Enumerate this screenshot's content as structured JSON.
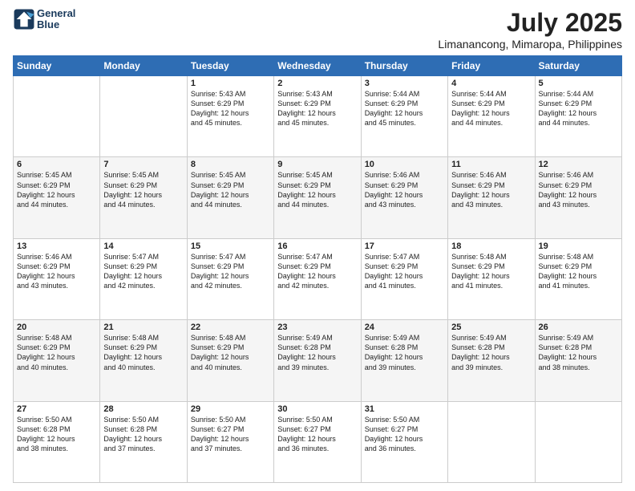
{
  "header": {
    "logo_line1": "General",
    "logo_line2": "Blue",
    "title": "July 2025",
    "subtitle": "Limanancong, Mimaropa, Philippines"
  },
  "weekdays": [
    "Sunday",
    "Monday",
    "Tuesday",
    "Wednesday",
    "Thursday",
    "Friday",
    "Saturday"
  ],
  "weeks": [
    [
      {
        "day": "",
        "info": ""
      },
      {
        "day": "",
        "info": ""
      },
      {
        "day": "1",
        "info": "Sunrise: 5:43 AM\nSunset: 6:29 PM\nDaylight: 12 hours\nand 45 minutes."
      },
      {
        "day": "2",
        "info": "Sunrise: 5:43 AM\nSunset: 6:29 PM\nDaylight: 12 hours\nand 45 minutes."
      },
      {
        "day": "3",
        "info": "Sunrise: 5:44 AM\nSunset: 6:29 PM\nDaylight: 12 hours\nand 45 minutes."
      },
      {
        "day": "4",
        "info": "Sunrise: 5:44 AM\nSunset: 6:29 PM\nDaylight: 12 hours\nand 44 minutes."
      },
      {
        "day": "5",
        "info": "Sunrise: 5:44 AM\nSunset: 6:29 PM\nDaylight: 12 hours\nand 44 minutes."
      }
    ],
    [
      {
        "day": "6",
        "info": "Sunrise: 5:45 AM\nSunset: 6:29 PM\nDaylight: 12 hours\nand 44 minutes."
      },
      {
        "day": "7",
        "info": "Sunrise: 5:45 AM\nSunset: 6:29 PM\nDaylight: 12 hours\nand 44 minutes."
      },
      {
        "day": "8",
        "info": "Sunrise: 5:45 AM\nSunset: 6:29 PM\nDaylight: 12 hours\nand 44 minutes."
      },
      {
        "day": "9",
        "info": "Sunrise: 5:45 AM\nSunset: 6:29 PM\nDaylight: 12 hours\nand 44 minutes."
      },
      {
        "day": "10",
        "info": "Sunrise: 5:46 AM\nSunset: 6:29 PM\nDaylight: 12 hours\nand 43 minutes."
      },
      {
        "day": "11",
        "info": "Sunrise: 5:46 AM\nSunset: 6:29 PM\nDaylight: 12 hours\nand 43 minutes."
      },
      {
        "day": "12",
        "info": "Sunrise: 5:46 AM\nSunset: 6:29 PM\nDaylight: 12 hours\nand 43 minutes."
      }
    ],
    [
      {
        "day": "13",
        "info": "Sunrise: 5:46 AM\nSunset: 6:29 PM\nDaylight: 12 hours\nand 43 minutes."
      },
      {
        "day": "14",
        "info": "Sunrise: 5:47 AM\nSunset: 6:29 PM\nDaylight: 12 hours\nand 42 minutes."
      },
      {
        "day": "15",
        "info": "Sunrise: 5:47 AM\nSunset: 6:29 PM\nDaylight: 12 hours\nand 42 minutes."
      },
      {
        "day": "16",
        "info": "Sunrise: 5:47 AM\nSunset: 6:29 PM\nDaylight: 12 hours\nand 42 minutes."
      },
      {
        "day": "17",
        "info": "Sunrise: 5:47 AM\nSunset: 6:29 PM\nDaylight: 12 hours\nand 41 minutes."
      },
      {
        "day": "18",
        "info": "Sunrise: 5:48 AM\nSunset: 6:29 PM\nDaylight: 12 hours\nand 41 minutes."
      },
      {
        "day": "19",
        "info": "Sunrise: 5:48 AM\nSunset: 6:29 PM\nDaylight: 12 hours\nand 41 minutes."
      }
    ],
    [
      {
        "day": "20",
        "info": "Sunrise: 5:48 AM\nSunset: 6:29 PM\nDaylight: 12 hours\nand 40 minutes."
      },
      {
        "day": "21",
        "info": "Sunrise: 5:48 AM\nSunset: 6:29 PM\nDaylight: 12 hours\nand 40 minutes."
      },
      {
        "day": "22",
        "info": "Sunrise: 5:48 AM\nSunset: 6:29 PM\nDaylight: 12 hours\nand 40 minutes."
      },
      {
        "day": "23",
        "info": "Sunrise: 5:49 AM\nSunset: 6:28 PM\nDaylight: 12 hours\nand 39 minutes."
      },
      {
        "day": "24",
        "info": "Sunrise: 5:49 AM\nSunset: 6:28 PM\nDaylight: 12 hours\nand 39 minutes."
      },
      {
        "day": "25",
        "info": "Sunrise: 5:49 AM\nSunset: 6:28 PM\nDaylight: 12 hours\nand 39 minutes."
      },
      {
        "day": "26",
        "info": "Sunrise: 5:49 AM\nSunset: 6:28 PM\nDaylight: 12 hours\nand 38 minutes."
      }
    ],
    [
      {
        "day": "27",
        "info": "Sunrise: 5:50 AM\nSunset: 6:28 PM\nDaylight: 12 hours\nand 38 minutes."
      },
      {
        "day": "28",
        "info": "Sunrise: 5:50 AM\nSunset: 6:28 PM\nDaylight: 12 hours\nand 37 minutes."
      },
      {
        "day": "29",
        "info": "Sunrise: 5:50 AM\nSunset: 6:27 PM\nDaylight: 12 hours\nand 37 minutes."
      },
      {
        "day": "30",
        "info": "Sunrise: 5:50 AM\nSunset: 6:27 PM\nDaylight: 12 hours\nand 36 minutes."
      },
      {
        "day": "31",
        "info": "Sunrise: 5:50 AM\nSunset: 6:27 PM\nDaylight: 12 hours\nand 36 minutes."
      },
      {
        "day": "",
        "info": ""
      },
      {
        "day": "",
        "info": ""
      }
    ]
  ]
}
